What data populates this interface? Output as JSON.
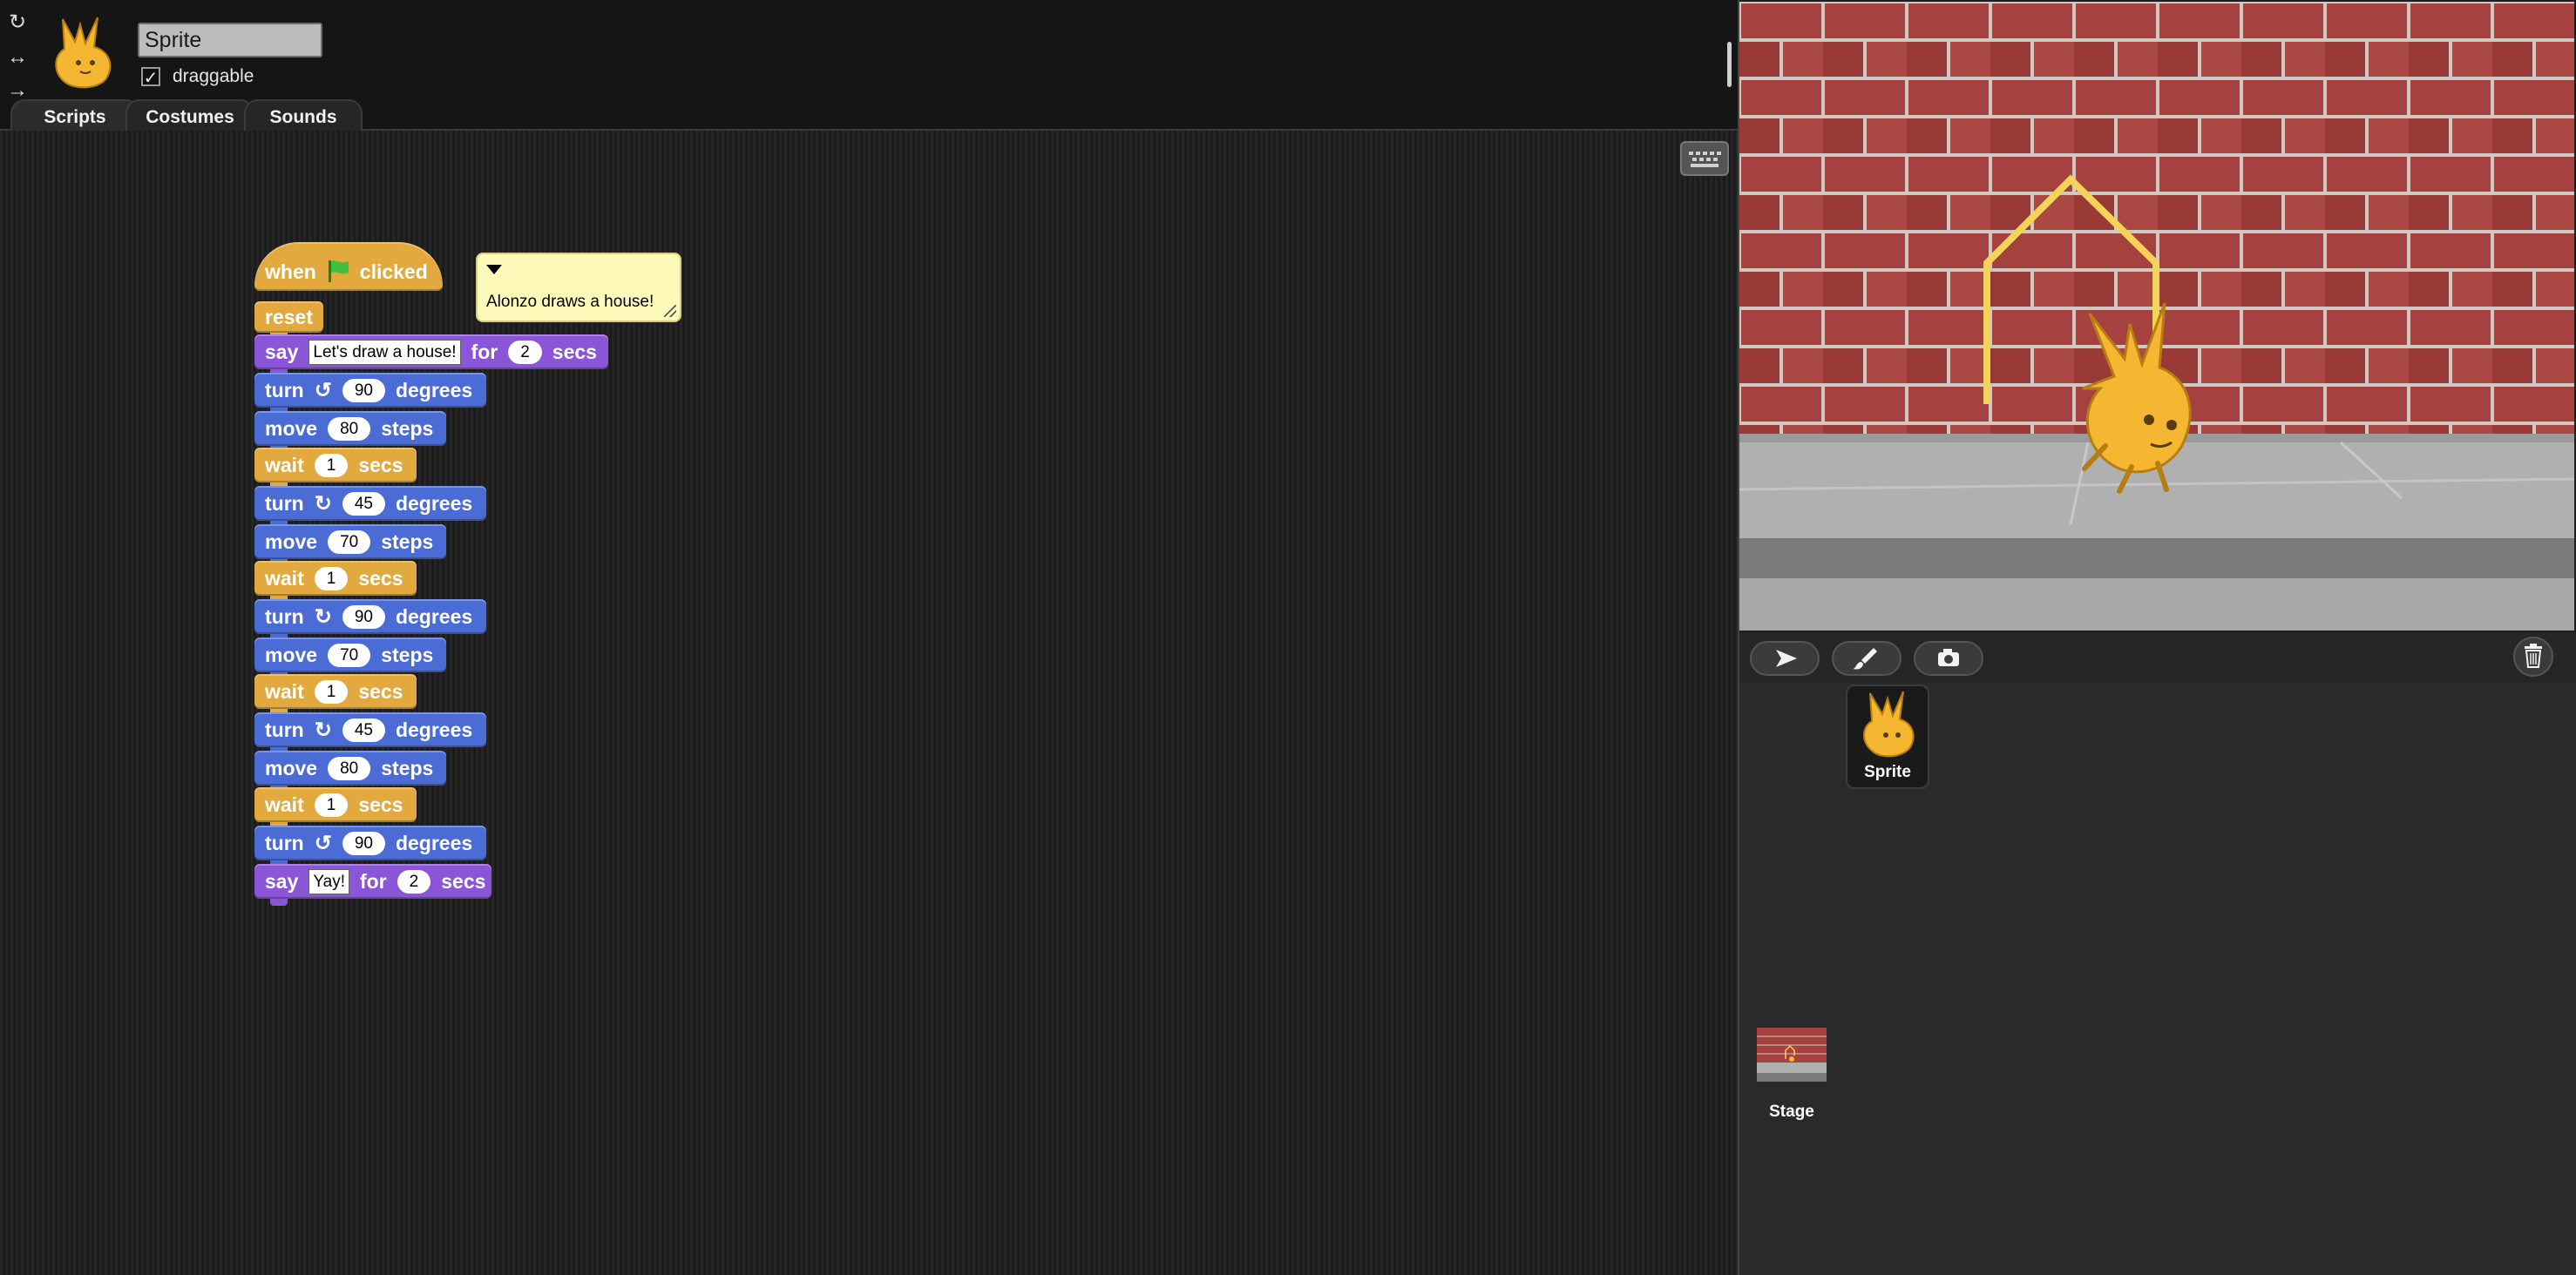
{
  "header": {
    "sprite_name": "Sprite",
    "draggable_label": "draggable",
    "draggable_checked": true,
    "rotation_styles": [
      "rotate-icon",
      "left-right-icon",
      "no-rotate-icon"
    ]
  },
  "tabs": [
    {
      "label": "Scripts",
      "active": true
    },
    {
      "label": "Costumes",
      "active": false
    },
    {
      "label": "Sounds",
      "active": false
    }
  ],
  "script": {
    "hat": {
      "pre": "when",
      "icon": "green-flag-icon",
      "post": "clicked"
    },
    "blocks": [
      {
        "category": "pen",
        "label": "reset"
      },
      {
        "category": "looks",
        "parts": [
          "say",
          "Let's draw a house!",
          "for",
          "2",
          "secs"
        ]
      },
      {
        "category": "motion",
        "parts": [
          "turn",
          "counterclockwise-icon",
          "90",
          "degrees"
        ]
      },
      {
        "category": "motion",
        "parts": [
          "move",
          "80",
          "steps"
        ]
      },
      {
        "category": "control",
        "parts": [
          "wait",
          "1",
          "secs"
        ]
      },
      {
        "category": "motion",
        "parts": [
          "turn",
          "clockwise-icon",
          "45",
          "degrees"
        ]
      },
      {
        "category": "motion",
        "parts": [
          "move",
          "70",
          "steps"
        ]
      },
      {
        "category": "control",
        "parts": [
          "wait",
          "1",
          "secs"
        ]
      },
      {
        "category": "motion",
        "parts": [
          "turn",
          "clockwise-icon",
          "90",
          "degrees"
        ]
      },
      {
        "category": "motion",
        "parts": [
          "move",
          "70",
          "steps"
        ]
      },
      {
        "category": "control",
        "parts": [
          "wait",
          "1",
          "secs"
        ]
      },
      {
        "category": "motion",
        "parts": [
          "turn",
          "clockwise-icon",
          "45",
          "degrees"
        ]
      },
      {
        "category": "motion",
        "parts": [
          "move",
          "80",
          "steps"
        ]
      },
      {
        "category": "control",
        "parts": [
          "wait",
          "1",
          "secs"
        ]
      },
      {
        "category": "motion",
        "parts": [
          "turn",
          "counterclockwise-icon",
          "90",
          "degrees"
        ]
      },
      {
        "category": "looks",
        "parts": [
          "say",
          "Yay!",
          "for",
          "2",
          "secs"
        ]
      }
    ],
    "comment": "Alonzo draws a house!"
  },
  "colors": {
    "control": "#e1a93e",
    "motion": "#4a6cd4",
    "looks": "#8a55d7",
    "pen_trail": "#f3d35a",
    "brick": "#9e3b38"
  },
  "corral": {
    "sprites": [
      {
        "name": "Sprite"
      }
    ],
    "stage_label": "Stage",
    "buttons": [
      "turtle-icon",
      "paintbrush-icon",
      "camera-icon",
      "trash-icon"
    ]
  }
}
